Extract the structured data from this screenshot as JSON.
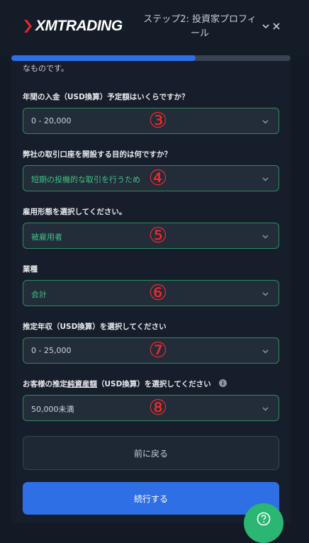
{
  "header": {
    "logo_text": "XMTRADING",
    "step_title": "ステップ2: 投資家プロフィール",
    "progress": 0.66
  },
  "form": {
    "intro_text": "なものです。",
    "questions": [
      {
        "label": "年間の入金（USD換算）予定額はいくらですか？",
        "value": "0 - 20,000",
        "marker": "③"
      },
      {
        "label": "弊社の取引口座を開設する目的は何ですか？",
        "value": "短期の投機的な取引を行うため",
        "marker": "④"
      },
      {
        "label": "雇用形態を選択してください。",
        "value": "被雇用者",
        "marker": "⑤"
      },
      {
        "label": "業種",
        "value": "会計",
        "marker": "⑥"
      },
      {
        "label": "推定年収（USD換算）を選択してください",
        "value": "0 - 25,000",
        "marker": "⑦"
      },
      {
        "label_prefix": "お客様の推定",
        "label_underlined": "純資産額",
        "label_suffix": "（USD換算）を選択してください",
        "value": "50,000未満",
        "marker": "⑧"
      }
    ]
  },
  "buttons": {
    "back": "前に戻る",
    "next": "続行する"
  },
  "colors": {
    "accent_blue": "#2f6fe6",
    "value_green": "#3fc483",
    "marker_red": "#ee2a2a",
    "fab_green": "#2bb673"
  }
}
